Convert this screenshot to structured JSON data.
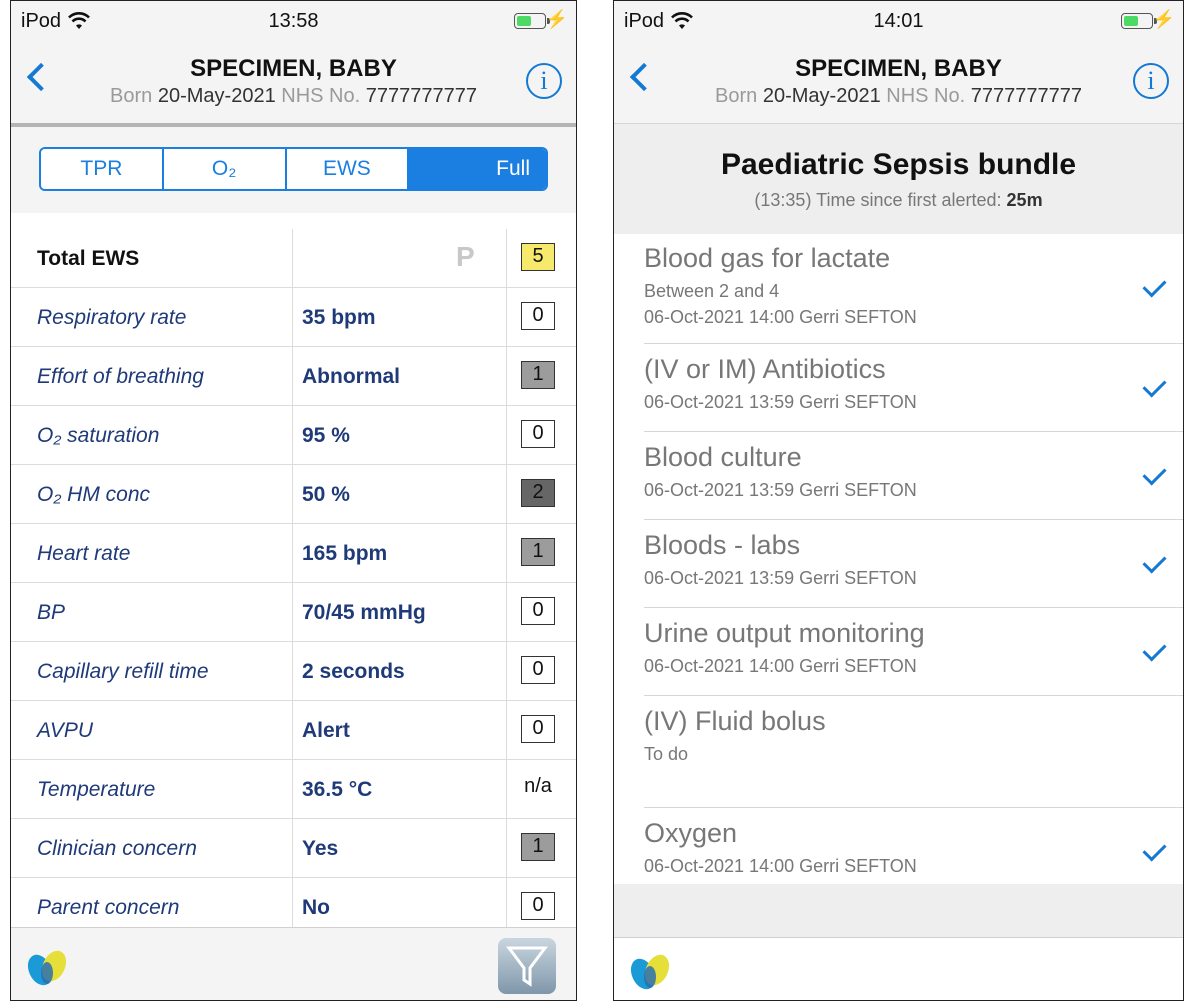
{
  "left": {
    "status": {
      "carrier": "iPod",
      "time": "13:58"
    },
    "header": {
      "name": "SPECIMEN, BABY",
      "born_label": "Born",
      "born_date": "20-May-2021",
      "nhs_label": "NHS No.",
      "nhs_number": "7777777777",
      "info_label": "i"
    },
    "tabs": [
      {
        "label": "TPR"
      },
      {
        "label": "O₂"
      },
      {
        "label": "EWS"
      },
      {
        "label": "Full",
        "active": true
      }
    ],
    "total": {
      "label": "Total EWS",
      "flag": "P",
      "score": "5"
    },
    "rows": [
      {
        "name": "Respiratory rate",
        "value": "35 bpm",
        "score": "0"
      },
      {
        "name": "Effort of breathing",
        "value": "Abnormal",
        "score": "1"
      },
      {
        "name": "O₂ saturation",
        "value": "95 %",
        "score": "0"
      },
      {
        "name": "O₂ HM conc",
        "value": "50 %",
        "score": "2"
      },
      {
        "name": "Heart rate",
        "value": "165 bpm",
        "score": "1"
      },
      {
        "name": "BP",
        "value": "70/45 mmHg",
        "score": "0"
      },
      {
        "name": "Capillary refill time",
        "value": "2 seconds",
        "score": "0"
      },
      {
        "name": "AVPU",
        "value": "Alert",
        "score": "0"
      },
      {
        "name": "Temperature",
        "value": "36.5 °C",
        "score": "n/a"
      },
      {
        "name": "Clinician concern",
        "value": "Yes",
        "score": "1"
      },
      {
        "name": "Parent concern",
        "value": "No",
        "score": "0"
      }
    ],
    "colors": {
      "accent": "#1a7fe0",
      "score1": "#9c9c9c",
      "score2": "#666666",
      "total": "#f7e96b"
    }
  },
  "right": {
    "status": {
      "carrier": "iPod",
      "time": "14:01"
    },
    "header": {
      "name": "SPECIMEN, BABY",
      "born_label": "Born",
      "born_date": "20-May-2021",
      "nhs_label": "NHS No.",
      "nhs_number": "7777777777",
      "info_label": "i"
    },
    "bundle": {
      "title": "Paediatric Sepsis bundle",
      "time": "(13:35)",
      "since_label": "Time since first alerted:",
      "since_value": "25m"
    },
    "items": [
      {
        "title": "Blood gas for lactate",
        "line1": "Between 2 and 4",
        "line2": "06-Oct-2021 14:00 Gerri SEFTON",
        "done": true
      },
      {
        "title": "(IV or IM) Antibiotics",
        "line1": "06-Oct-2021 13:59 Gerri SEFTON",
        "line2": "",
        "done": true
      },
      {
        "title": "Blood culture",
        "line1": "06-Oct-2021 13:59 Gerri SEFTON",
        "line2": "",
        "done": true
      },
      {
        "title": "Bloods - labs",
        "line1": "06-Oct-2021 13:59 Gerri SEFTON",
        "line2": "",
        "done": true
      },
      {
        "title": "Urine output monitoring",
        "line1": "06-Oct-2021 14:00 Gerri SEFTON",
        "line2": "",
        "done": true
      },
      {
        "title": "(IV) Fluid bolus",
        "line1": "To do",
        "line2": "",
        "done": false
      },
      {
        "title": "Oxygen",
        "line1": "06-Oct-2021 14:00 Gerri SEFTON",
        "line2": "",
        "done": true
      }
    ]
  }
}
